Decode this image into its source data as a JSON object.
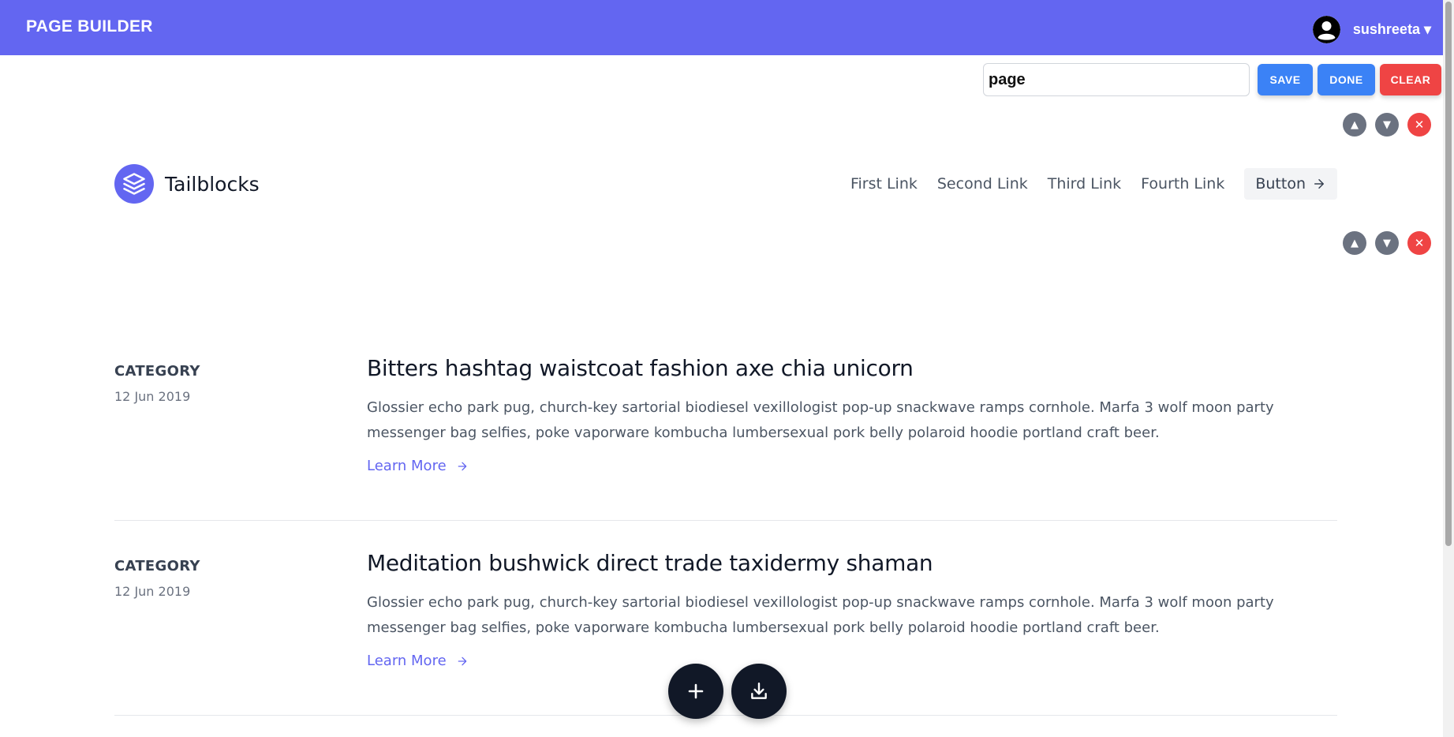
{
  "app": {
    "title": "PAGE BUILDER",
    "user": {
      "name": "sushreeta ▾"
    }
  },
  "toolbar": {
    "page_name": "page",
    "save_label": "SAVE",
    "done_label": "DONE",
    "clear_label": "CLEAR"
  },
  "section_controls": {
    "up": "▲",
    "down": "▼",
    "remove": "✕"
  },
  "header_block": {
    "brand": "Tailblocks",
    "nav": [
      "First Link",
      "Second Link",
      "Third Link",
      "Fourth Link"
    ],
    "button_label": "Button"
  },
  "posts": [
    {
      "category": "CATEGORY",
      "date": "12 Jun 2019",
      "title": "Bitters hashtag waistcoat fashion axe chia unicorn",
      "description": "Glossier echo park pug, church-key sartorial biodiesel vexillologist pop-up snackwave ramps cornhole. Marfa 3 wolf moon party messenger bag selfies, poke vaporware kombucha lumbersexual pork belly polaroid hoodie portland craft beer.",
      "link": "Learn More"
    },
    {
      "category": "CATEGORY",
      "date": "12 Jun 2019",
      "title": "Meditation bushwick direct trade taxidermy shaman",
      "description": "Glossier echo park pug, church-key sartorial biodiesel vexillologist pop-up snackwave ramps cornhole. Marfa 3 wolf moon party messenger bag selfies, poke vaporware kombucha lumbersexual pork belly polaroid hoodie portland craft beer.",
      "link": "Learn More"
    }
  ],
  "colors": {
    "appbar": "#6366f1",
    "primary_button": "#3b82f6",
    "danger_button": "#ef4444",
    "link": "#6366f1",
    "fab": "#111827"
  },
  "icons": {
    "avatar": "user-circle-icon",
    "logo": "layers-icon",
    "arrow": "arrow-right-icon",
    "add": "plus-icon",
    "download": "download-icon"
  }
}
